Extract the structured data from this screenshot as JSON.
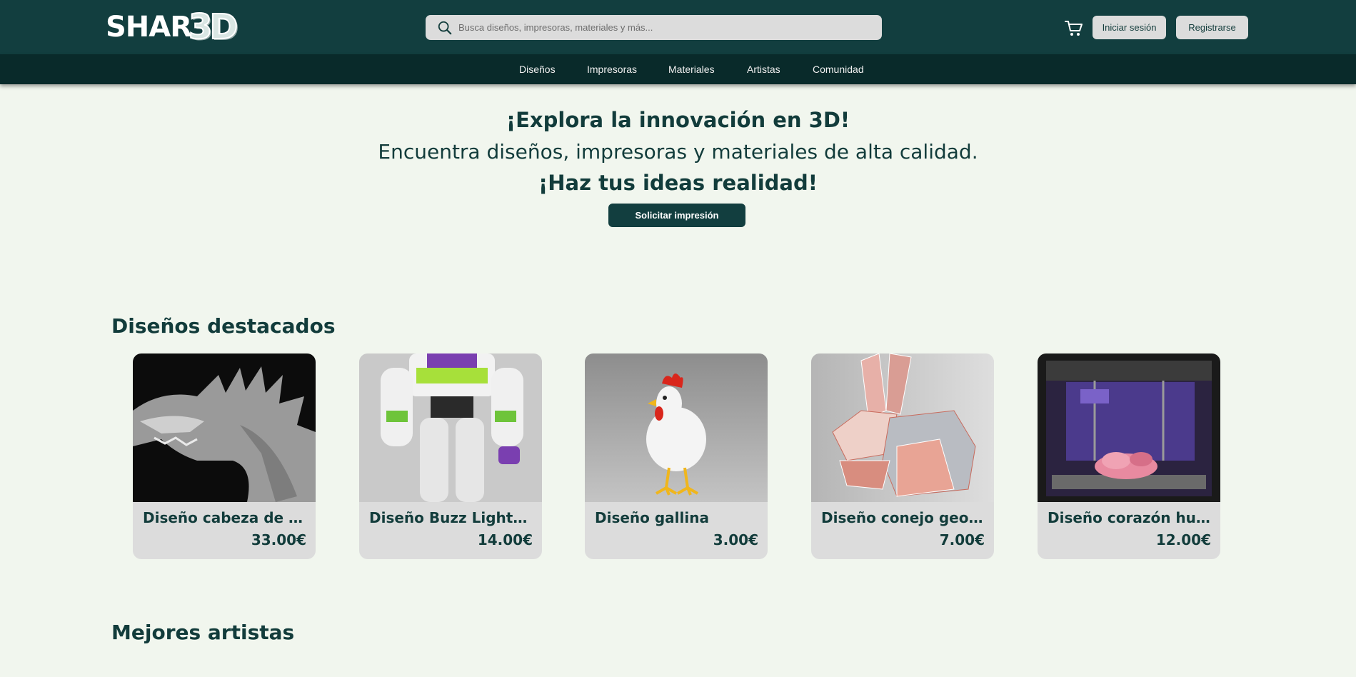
{
  "brand": {
    "logo_main": "SHAR",
    "logo_accent": "3D"
  },
  "header": {
    "search_placeholder": "Busca diseños, impresoras, materiales y más...",
    "search_icon": "search-icon",
    "cart_icon": "cart-icon",
    "login_label": "Iniciar sesión",
    "register_label": "Registrarse"
  },
  "nav": {
    "items": [
      {
        "label": "Diseños"
      },
      {
        "label": "Impresoras"
      },
      {
        "label": "Materiales"
      },
      {
        "label": "Artistas"
      },
      {
        "label": "Comunidad"
      }
    ]
  },
  "hero": {
    "title": "¡Explora la innovación en 3D!",
    "subtitle": "Encuentra diseños, impresoras y materiales de alta calidad.",
    "tagline": "¡Haz tus ideas realidad!",
    "cta_label": "Solicitar impresión"
  },
  "featured": {
    "title": "Diseños destacados",
    "cards": [
      {
        "title": "Diseño cabeza de dragón",
        "price": "33.00€"
      },
      {
        "title": "Diseño Buzz Lightyear",
        "price": "14.00€"
      },
      {
        "title": "Diseño gallina",
        "price": "3.00€"
      },
      {
        "title": "Diseño conejo geométrico",
        "price": "7.00€"
      },
      {
        "title": "Diseño corazón humano",
        "price": "12.00€"
      }
    ]
  },
  "artists": {
    "title": "Mejores artistas"
  },
  "colors": {
    "header_bg": "#123e3f",
    "nav_bg": "#092a2a",
    "page_bg": "#f1f6ee",
    "text_dark": "#123c3b",
    "button_light": "#dcdcdc"
  }
}
